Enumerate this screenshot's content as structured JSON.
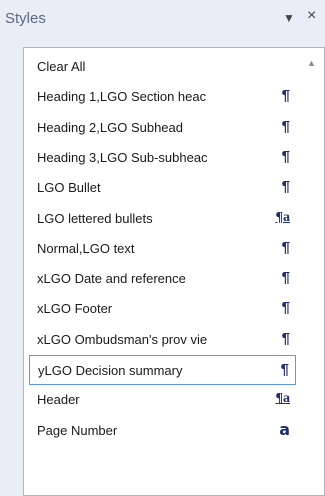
{
  "pane": {
    "title": "Styles",
    "menu_icon": "▼",
    "close_icon": "×"
  },
  "styles_list": {
    "scroll_up_icon": "▲",
    "items": [
      {
        "label": "Clear All",
        "glyph": ""
      },
      {
        "label": "Heading 1,LGO Section heac",
        "glyph": "¶"
      },
      {
        "label": "Heading 2,LGO Subhead",
        "glyph": "¶"
      },
      {
        "label": "Heading 3,LGO Sub-subheac",
        "glyph": "¶"
      },
      {
        "label": "LGO Bullet",
        "glyph": "¶"
      },
      {
        "label": "LGO lettered bullets",
        "glyph": "¶a"
      },
      {
        "label": "Normal,LGO text",
        "glyph": "¶"
      },
      {
        "label": "xLGO Date and reference",
        "glyph": "¶"
      },
      {
        "label": "xLGO Footer",
        "glyph": "¶"
      },
      {
        "label": "xLGO Ombudsman's prov vie",
        "glyph": "¶"
      },
      {
        "label": "yLGO Decision summary",
        "glyph": "¶"
      },
      {
        "label": "Header",
        "glyph": "¶a"
      },
      {
        "label": "Page Number",
        "glyph": "a"
      }
    ],
    "selected_index": 10
  }
}
